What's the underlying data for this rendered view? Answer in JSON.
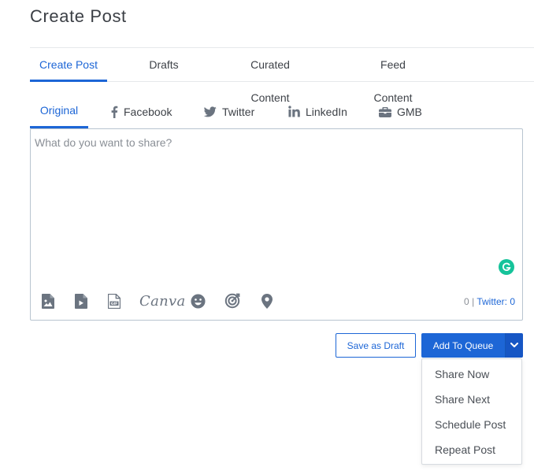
{
  "page": {
    "title": "Create Post"
  },
  "main_tabs": [
    {
      "label": "Create Post",
      "active": true
    },
    {
      "label": "Drafts",
      "active": false
    },
    {
      "label": "Curated Content",
      "active": false
    },
    {
      "label": "Feed Content",
      "active": false
    }
  ],
  "network_tabs": [
    {
      "label": "Original",
      "icon": "none",
      "active": true
    },
    {
      "label": "Facebook",
      "icon": "facebook-icon",
      "active": false
    },
    {
      "label": "Twitter",
      "icon": "twitter-icon",
      "active": false
    },
    {
      "label": "LinkedIn",
      "icon": "linkedin-icon",
      "active": false
    },
    {
      "label": "GMB",
      "icon": "briefcase-icon",
      "active": false
    }
  ],
  "editor": {
    "placeholder": "What do you want to share?",
    "value": "",
    "canva_label": "Canva",
    "toolbar_icons": [
      "image-icon",
      "video-icon",
      "gif-icon",
      "canva-icon",
      "emoji-icon",
      "target-icon",
      "location-icon"
    ],
    "counter_total": "0",
    "counter_separator": " | ",
    "counter_twitter": "Twitter: 0"
  },
  "actions": {
    "save_draft_label": "Save as Draft",
    "add_to_queue_label": "Add To Queue",
    "dropdown_items": [
      "Share Now",
      "Share Next",
      "Schedule Post",
      "Repeat Post"
    ]
  },
  "colors": {
    "accent": "#1d66d6",
    "grammarly": "#15c39a",
    "icon_gray": "#6b7480"
  }
}
